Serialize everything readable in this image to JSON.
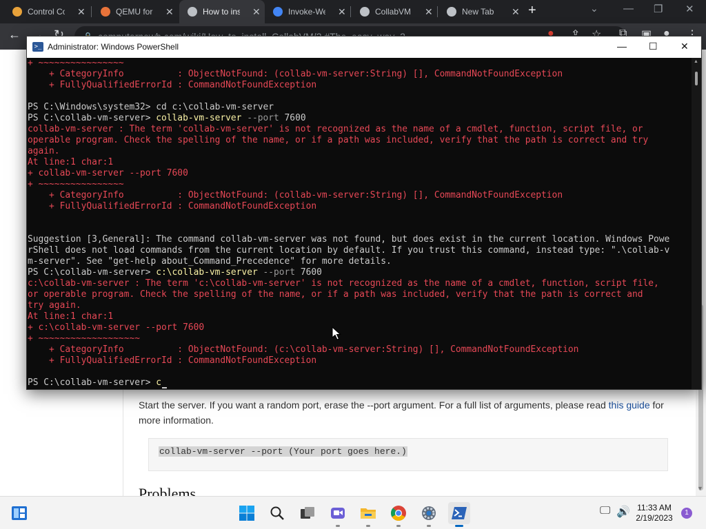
{
  "browser": {
    "tabs": [
      {
        "title": "Control Col",
        "icon": "control-panel-icon",
        "color": "#e8a23a"
      },
      {
        "title": "QEMU for \\",
        "icon": "qemu-icon",
        "color": "#e8733a"
      },
      {
        "title": "How to inst",
        "icon": "computernewb-icon",
        "color": "#bdc1c6"
      },
      {
        "title": "Invoke-Wel",
        "icon": "google-icon",
        "color": "#4285f4"
      },
      {
        "title": "CollabVM",
        "icon": "computernewb-icon",
        "color": "#bdc1c6"
      },
      {
        "title": "New Tab",
        "icon": "chrome-icon",
        "color": "#bdc1c6"
      }
    ],
    "url": "computernewb.com/wiki/How_to_install_CollabVM/2.#The_easy_way_2"
  },
  "webpage": {
    "paragraph_before_link": "Start the server. If you want a random port, erase the --port argument. For a full list of arguments, please read ",
    "link_text": "this guide",
    "paragraph_after_link": " for more information.",
    "code": "collab-vm-server --port (Your port goes here.)",
    "heading": "Problems"
  },
  "powershell": {
    "title": "Administrator: Windows PowerShell",
    "lines": [
      {
        "t": "e",
        "s": "+ ~~~~~~~~~~~~~~~~"
      },
      {
        "t": "e",
        "s": "    + CategoryInfo          : ObjectNotFound: (collab-vm-server:String) [], CommandNotFoundException"
      },
      {
        "t": "e",
        "s": "    + FullyQualifiedErrorId : CommandNotFoundException"
      },
      {
        "t": "n",
        "s": ""
      },
      {
        "t": "n",
        "s": "PS C:\\Windows\\system32> cd c:\\collab-vm-server"
      },
      {
        "t": "c",
        "p": "PS C:\\collab-vm-server> ",
        "c": "collab-vm-server",
        "a": " --port",
        "v": " 7600"
      },
      {
        "t": "e",
        "s": "collab-vm-server : The term 'collab-vm-server' is not recognized as the name of a cmdlet, function, script file, or"
      },
      {
        "t": "e",
        "s": "operable program. Check the spelling of the name, or if a path was included, verify that the path is correct and try"
      },
      {
        "t": "e",
        "s": "again."
      },
      {
        "t": "e",
        "s": "At line:1 char:1"
      },
      {
        "t": "e",
        "s": "+ collab-vm-server --port 7600"
      },
      {
        "t": "e",
        "s": "+ ~~~~~~~~~~~~~~~~"
      },
      {
        "t": "e",
        "s": "    + CategoryInfo          : ObjectNotFound: (collab-vm-server:String) [], CommandNotFoundException"
      },
      {
        "t": "e",
        "s": "    + FullyQualifiedErrorId : CommandNotFoundException"
      },
      {
        "t": "n",
        "s": ""
      },
      {
        "t": "n",
        "s": ""
      },
      {
        "t": "n",
        "s": "Suggestion [3,General]: The command collab-vm-server was not found, but does exist in the current location. Windows Powe"
      },
      {
        "t": "n",
        "s": "rShell does not load commands from the current location by default. If you trust this command, instead type: \".\\collab-v"
      },
      {
        "t": "n",
        "s": "m-server\". See \"get-help about_Command_Precedence\" for more details."
      },
      {
        "t": "c",
        "p": "PS C:\\collab-vm-server> ",
        "c": "c:\\collab-vm-server",
        "a": " --port",
        "v": " 7600"
      },
      {
        "t": "e",
        "s": "c:\\collab-vm-server : The term 'c:\\collab-vm-server' is not recognized as the name of a cmdlet, function, script file,"
      },
      {
        "t": "e",
        "s": "or operable program. Check the spelling of the name, or if a path was included, verify that the path is correct and"
      },
      {
        "t": "e",
        "s": "try again."
      },
      {
        "t": "e",
        "s": "At line:1 char:1"
      },
      {
        "t": "e",
        "s": "+ c:\\collab-vm-server --port 7600"
      },
      {
        "t": "e",
        "s": "+ ~~~~~~~~~~~~~~~~~~~"
      },
      {
        "t": "e",
        "s": "    + CategoryInfo          : ObjectNotFound: (c:\\collab-vm-server:String) [], CommandNotFoundException"
      },
      {
        "t": "e",
        "s": "    + FullyQualifiedErrorId : CommandNotFoundException"
      },
      {
        "t": "n",
        "s": ""
      },
      {
        "t": "p",
        "p": "PS C:\\collab-vm-server> ",
        "c": "c"
      }
    ]
  },
  "taskbar": {
    "clock_time": "11:33 AM",
    "clock_date": "2/19/2023",
    "notification_count": "1",
    "pinned": [
      "widgets-icon",
      "start-icon",
      "search-icon",
      "task-view-icon",
      "chat-icon",
      "file-explorer-icon",
      "chrome-icon",
      "settings-icon",
      "powershell-icon"
    ],
    "active": "powershell-icon"
  },
  "colors": {
    "console_bg": "#0c0c0c",
    "console_fg": "#cccccc",
    "error": "#e74856",
    "command": "#f9f1a5",
    "param": "#9a9a9a",
    "accent": "#0067c0"
  }
}
